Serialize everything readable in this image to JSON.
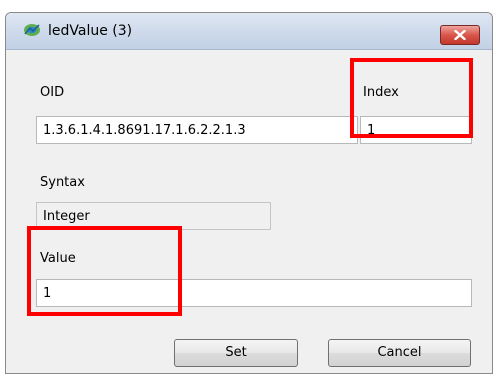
{
  "window": {
    "title": "ledValue (3)",
    "icon": "snmp-app-icon",
    "close_icon": "close-icon"
  },
  "form": {
    "oid_label": "OID",
    "oid_value": "1.3.6.1.4.1.8691.17.1.6.2.2.1.3",
    "index_label": "Index",
    "index_value": "1",
    "syntax_label": "Syntax",
    "syntax_value": "Integer",
    "value_label": "Value",
    "value_value": "1"
  },
  "buttons": {
    "set_label": "Set",
    "cancel_label": "Cancel"
  },
  "colors": {
    "highlight": "#ff0000",
    "close_button": "#d9564a"
  }
}
